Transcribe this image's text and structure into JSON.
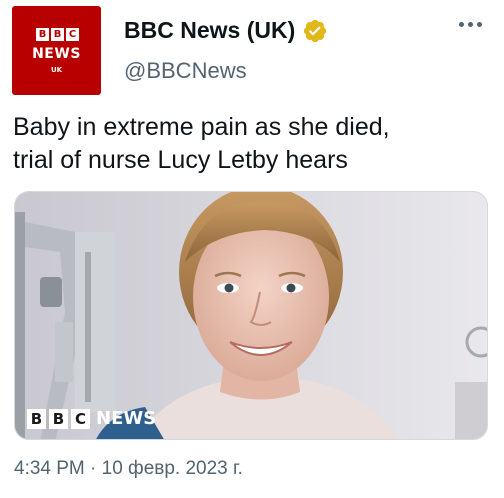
{
  "account": {
    "avatar": {
      "letters": [
        "B",
        "B",
        "C"
      ],
      "wordmark": "NEWS",
      "region": "UK"
    },
    "display_name": "BBC News (UK)",
    "handle": "@BBCNews",
    "verified_icon": "verified-badge-icon",
    "verified_color": "#e2b719"
  },
  "tweet": {
    "text_line1": "Baby in extreme pain as she died,",
    "text_line2": "trial of nurse Lucy Letby hears",
    "timestamp": "4:34 PM · 10 февр. 2023 г."
  },
  "media": {
    "logo_letters": [
      "B",
      "B",
      "C"
    ],
    "logo_word": "NEWS"
  },
  "icons": {
    "menu": "more-options-icon"
  },
  "colors": {
    "brand_red": "#b80000",
    "secondary_text": "#536471",
    "primary_text": "#0f1419"
  }
}
